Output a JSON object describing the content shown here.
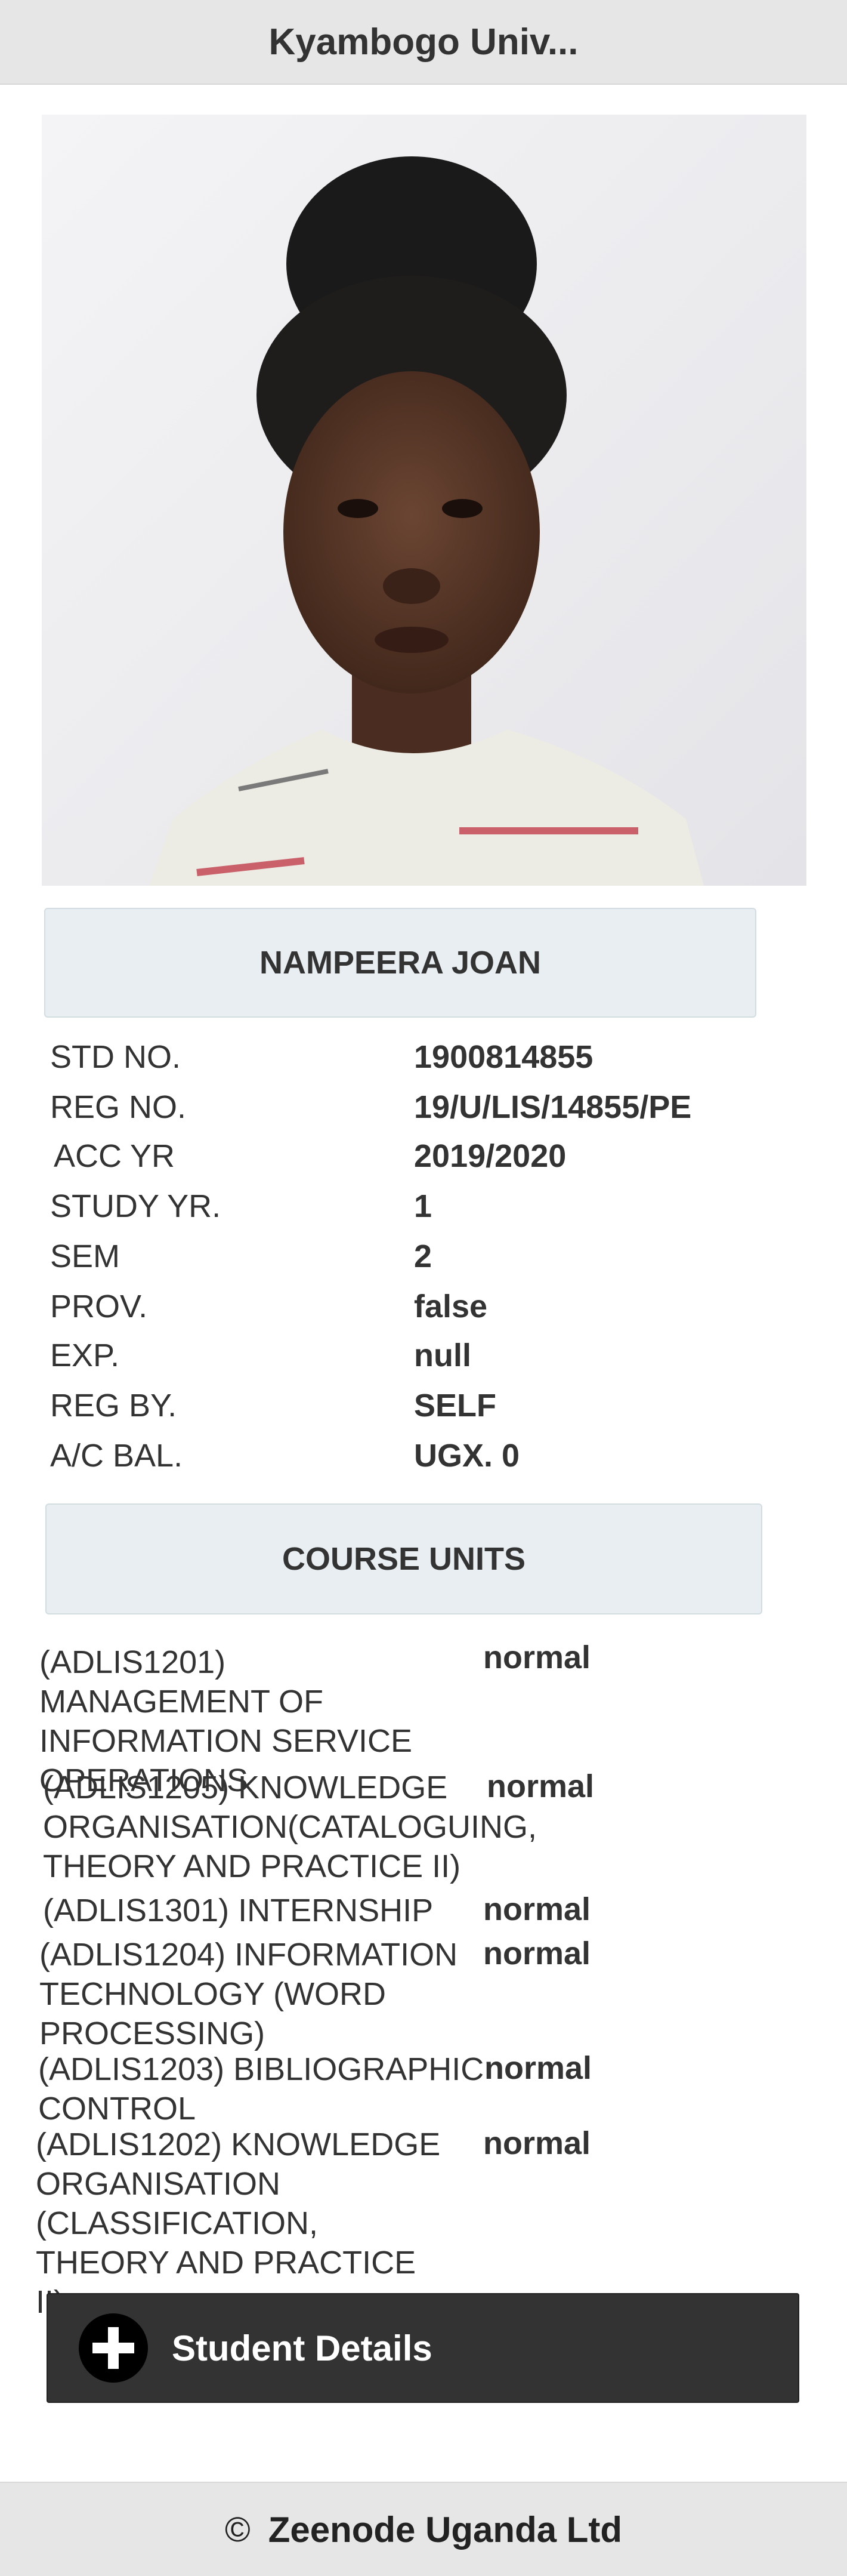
{
  "header": {
    "title": "Kyambogo Univ..."
  },
  "student": {
    "name": "NAMPEERA JOAN"
  },
  "info": [
    {
      "label": "STD NO.",
      "value": "1900814855"
    },
    {
      "label": "REG NO.",
      "value": "19/U/LIS/14855/PE"
    },
    {
      "label": "ACC YR",
      "value": "2019/2020"
    },
    {
      "label": "STUDY YR.",
      "value": "1"
    },
    {
      "label": "SEM",
      "value": "2"
    },
    {
      "label": "PROV.",
      "value": "false"
    },
    {
      "label": "EXP.",
      "value": "null"
    },
    {
      "label": "REG BY.",
      "value": "SELF"
    },
    {
      "label": "A/C BAL.",
      "value": "UGX. 0"
    }
  ],
  "course_units": {
    "heading": "COURSE UNITS",
    "items": [
      {
        "name": "(ADLIS1201) MANAGEMENT OF INFORMATION SERVICE OPERATIONS",
        "status": "normal"
      },
      {
        "name": "(ADLIS1205) KNOWLEDGE ORGANISATION(CATALOGUING, THEORY AND PRACTICE II)",
        "status": "normal"
      },
      {
        "name": "(ADLIS1301) INTERNSHIP",
        "status": "normal"
      },
      {
        "name": "(ADLIS1204) INFORMATION TECHNOLOGY (WORD PROCESSING)",
        "status": "normal"
      },
      {
        "name": "(ADLIS1203) BIBLIOGRAPHIC CONTROL",
        "status": "normal"
      },
      {
        "name": "(ADLIS1202) KNOWLEDGE ORGANISATION (CLASSIFICATION, THEORY AND PRACTICE II)",
        "status": "normal"
      }
    ]
  },
  "actions": {
    "student_details_label": "Student Details",
    "student_details_icon": "plus-circle-icon"
  },
  "footer": {
    "copyright_symbol": "©",
    "org": "Zeenode Uganda Ltd"
  },
  "colors": {
    "header_bg": "#e6e6e6",
    "box_bg": "#e8eef1",
    "button_bg": "#333333",
    "button_text": "#ffffff"
  }
}
